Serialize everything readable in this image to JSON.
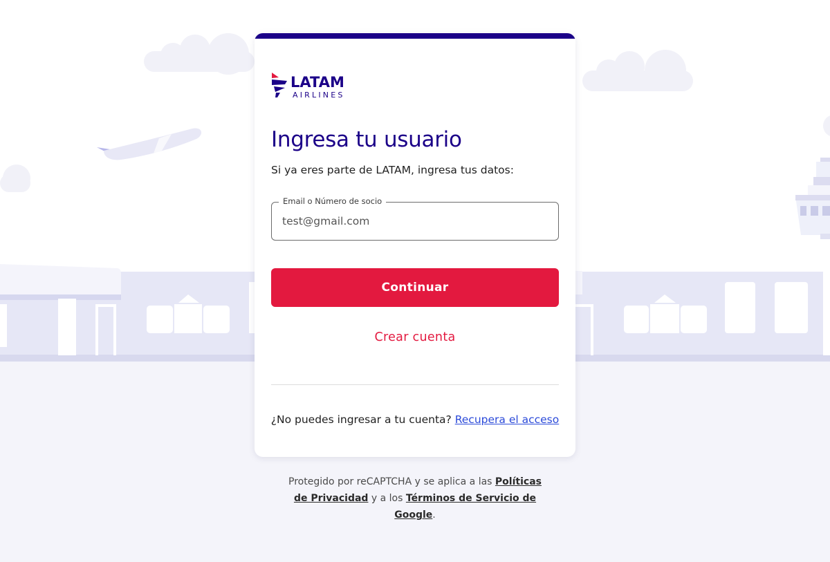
{
  "colors": {
    "brand_navy": "#1b0088",
    "brand_red": "#e3193f",
    "link_blue": "#2b4ad9",
    "background_lavender": "#eceef8"
  },
  "logo": {
    "brand": "LATAM",
    "sub": "AIRLINES"
  },
  "login": {
    "title": "Ingresa tu usuario",
    "subtitle": "Si ya eres parte de LATAM, ingresa tus datos:",
    "field": {
      "label": "Email o Número de socio",
      "value": "test@gmail.com"
    },
    "continue_label": "Continuar",
    "create_account_label": "Crear cuenta",
    "help_text": "¿No puedes ingresar a tu cuenta?",
    "recover_link": "Recupera el acceso"
  },
  "footer": {
    "text_1": "Protegido por reCAPTCHA y se aplica a las",
    "privacy_link": "Políticas de Privacidad",
    "text_2": "y a los",
    "terms_link": "Términos de Servicio de Google",
    "text_3": "."
  },
  "background": {
    "illustration": "airport-illustration"
  }
}
